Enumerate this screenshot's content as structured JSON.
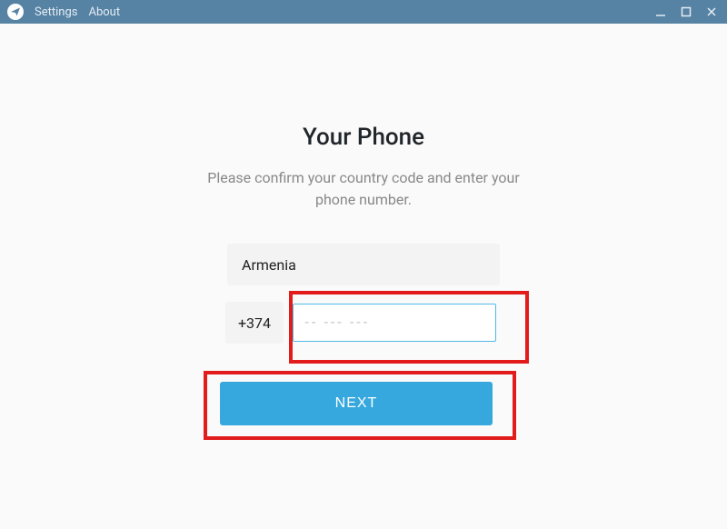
{
  "titlebar": {
    "menu": {
      "settings": "Settings",
      "about": "About"
    }
  },
  "page": {
    "title": "Your Phone",
    "subtitle": "Please confirm your country code and enter your phone number."
  },
  "form": {
    "country": "Armenia",
    "country_code": "+374",
    "phone_value": "",
    "phone_placeholder": "-- --- ---",
    "next_label": "NEXT"
  },
  "icons": {
    "app": "paper-plane",
    "minimize": "minimize",
    "maximize": "maximize",
    "close": "close"
  },
  "highlights": {
    "phone_input": true,
    "next_button": true
  }
}
